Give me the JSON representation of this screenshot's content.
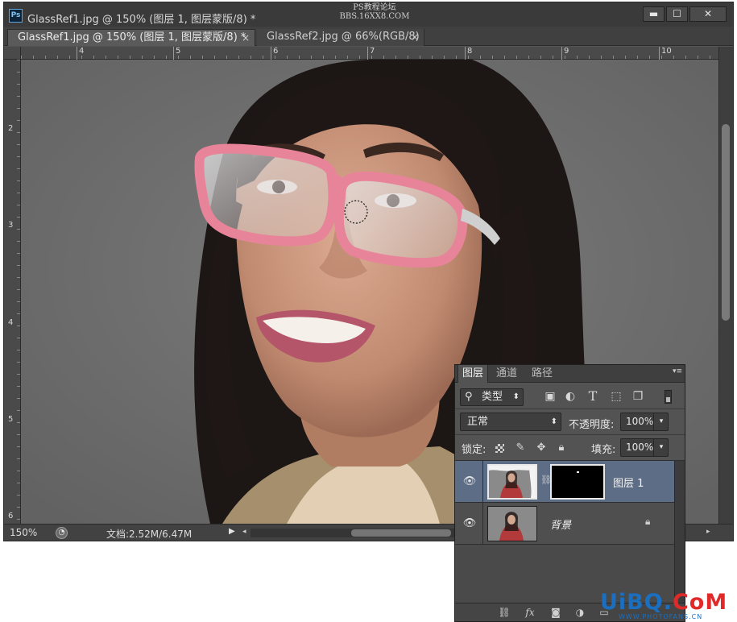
{
  "window": {
    "app_icon": "Ps",
    "title": "GlassRef1.jpg @ 150% (图层 1, 图层蒙版/8) *",
    "controls": {
      "minimize": "▬",
      "maximize": "☐",
      "close": "✕"
    }
  },
  "watermark_top": {
    "line1": "PS教程论坛",
    "line2": "BBS.16XX8.COM"
  },
  "tabs": [
    {
      "label": "GlassRef1.jpg @ 150% (图层 1, 图层蒙版/8) *",
      "active": true,
      "close": "×"
    },
    {
      "label": "GlassRef2.jpg @ 66%(RGB/8)",
      "active": false,
      "close": "×"
    }
  ],
  "rulers": {
    "top_ticks": [
      "4",
      "5",
      "6",
      "7",
      "8",
      "9",
      "10"
    ],
    "left_ticks": [
      "2",
      "3",
      "4",
      "5",
      "6"
    ]
  },
  "status": {
    "zoom": "150%",
    "doc_size": "文档:2.52M/6.47M",
    "menu_arrow": "▶",
    "scroll_left": "◂",
    "scroll_right": "▸"
  },
  "layers_panel": {
    "tabs": [
      "图层",
      "通道",
      "路径"
    ],
    "menu_icon": "▾≡",
    "filter": {
      "icon": "⚲",
      "label": "类型",
      "arrow": "⬍"
    },
    "filter_icons": [
      "pixel-filter-icon",
      "adjustment-filter-icon",
      "type-filter-icon",
      "shape-filter-icon",
      "smart-object-filter-icon"
    ],
    "blend_mode": "正常",
    "opacity_label": "不透明度:",
    "opacity": "100%",
    "lock_label": "锁定:",
    "fill_label": "填充:",
    "fill": "100%",
    "layers": [
      {
        "name": "图层 1",
        "visible": true,
        "selected": true,
        "has_mask": true
      },
      {
        "name": "背景",
        "visible": true,
        "selected": false,
        "locked": true
      }
    ],
    "footer_icons": [
      "link-layers-icon",
      "fx-icon",
      "add-mask-icon",
      "adjustment-layer-icon",
      "new-group-icon"
    ]
  },
  "watermark_br": {
    "part1": "UiBQ.",
    "part2": "CoM",
    "sub": "WWW.PHOTOFANS.CN"
  },
  "colors": {
    "selected_layer": "#5d6d86",
    "frame_pink": "#e8849a",
    "canvas_bg": "#727272"
  }
}
